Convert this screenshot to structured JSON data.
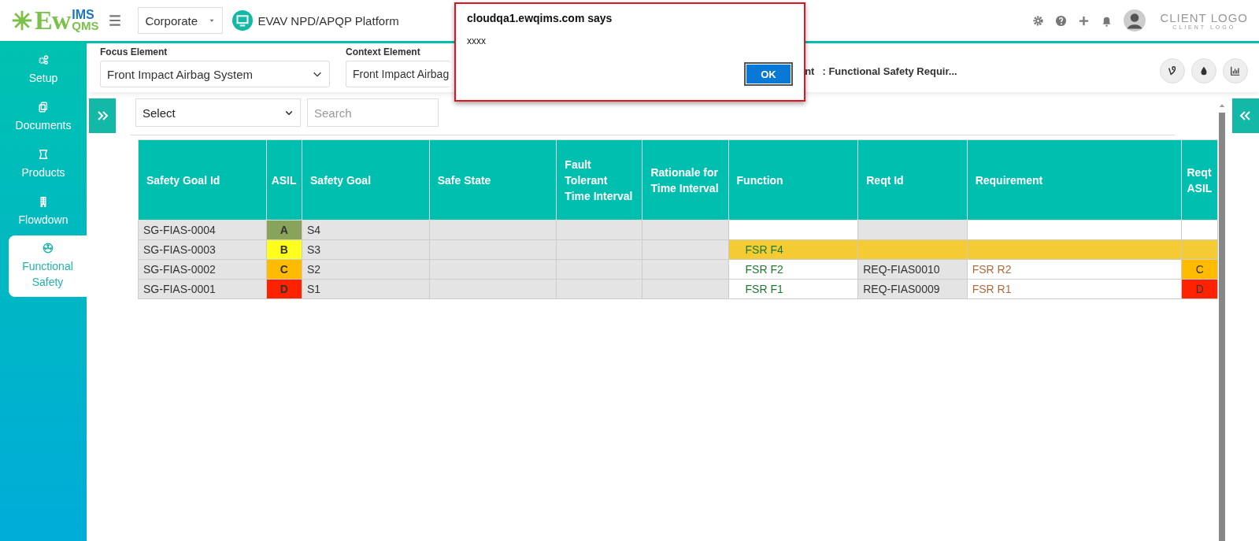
{
  "header": {
    "logo": {
      "main": "Ew",
      "top": "IMS",
      "bottom": "QMS"
    },
    "org_select": {
      "value": "Corporate"
    },
    "platform": "EVAV NPD/APQP Platform",
    "client_logo": {
      "title": "CLIENT LOGO",
      "subtitle": "CLIENT LOGO"
    }
  },
  "sidebar": {
    "items": [
      {
        "label": "Setup",
        "selected": false
      },
      {
        "label": "Documents",
        "selected": false
      },
      {
        "label": "Products",
        "selected": false
      },
      {
        "label": "Flowdown",
        "selected": false
      },
      {
        "label": "Functional Safety",
        "selected": true
      }
    ]
  },
  "context_bar": {
    "fields": [
      {
        "label": "Focus Element",
        "value": "Front Impact Airbag System"
      },
      {
        "label": "Context Element",
        "value": "Front Impact Airbag"
      }
    ],
    "fragment": "nt",
    "breadcrumb": ": Functional Safety Requir..."
  },
  "filters": {
    "select": {
      "value": "Select"
    },
    "search": {
      "placeholder": "Search"
    }
  },
  "table": {
    "columns": [
      "Safety Goal Id",
      "ASIL",
      "Safety Goal",
      "Safe State",
      "Fault Tolerant Time Interval",
      "Rationale for Time Interval",
      "Function",
      "Reqt Id",
      "Requirement",
      "Reqt ASIL"
    ],
    "rows": [
      {
        "safety_goal_id": "SG-FIAS-0004",
        "asil": {
          "text": "A",
          "color": "#8aa35a"
        },
        "safety_goal": "S4",
        "highlighted": false
      },
      {
        "safety_goal_id": "SG-FIAS-0003",
        "asil": {
          "text": "B",
          "color": "#ffff1e"
        },
        "safety_goal": "S3",
        "function": "FSR F4",
        "highlighted": true
      },
      {
        "safety_goal_id": "SG-FIAS-0002",
        "asil": {
          "text": "C",
          "color": "#ffbb00"
        },
        "safety_goal": "S2",
        "function": "FSR F2",
        "reqt_id": "REQ-FIAS0010",
        "requirement": "FSR R2",
        "reqt_asil": {
          "text": "C",
          "color": "#ffbb00"
        },
        "highlighted": false
      },
      {
        "safety_goal_id": "SG-FIAS-0001",
        "asil": {
          "text": "D",
          "color": "#ff2200"
        },
        "safety_goal": "S1",
        "function": "FSR F1",
        "reqt_id": "REQ-FIAS0009",
        "requirement": "FSR R1",
        "reqt_asil": {
          "text": "D",
          "color": "#ff2200"
        },
        "highlighted": false
      }
    ]
  },
  "dialog": {
    "title": "cloudqa1.ewqims.com says",
    "message": "xxxx",
    "button": "OK"
  }
}
